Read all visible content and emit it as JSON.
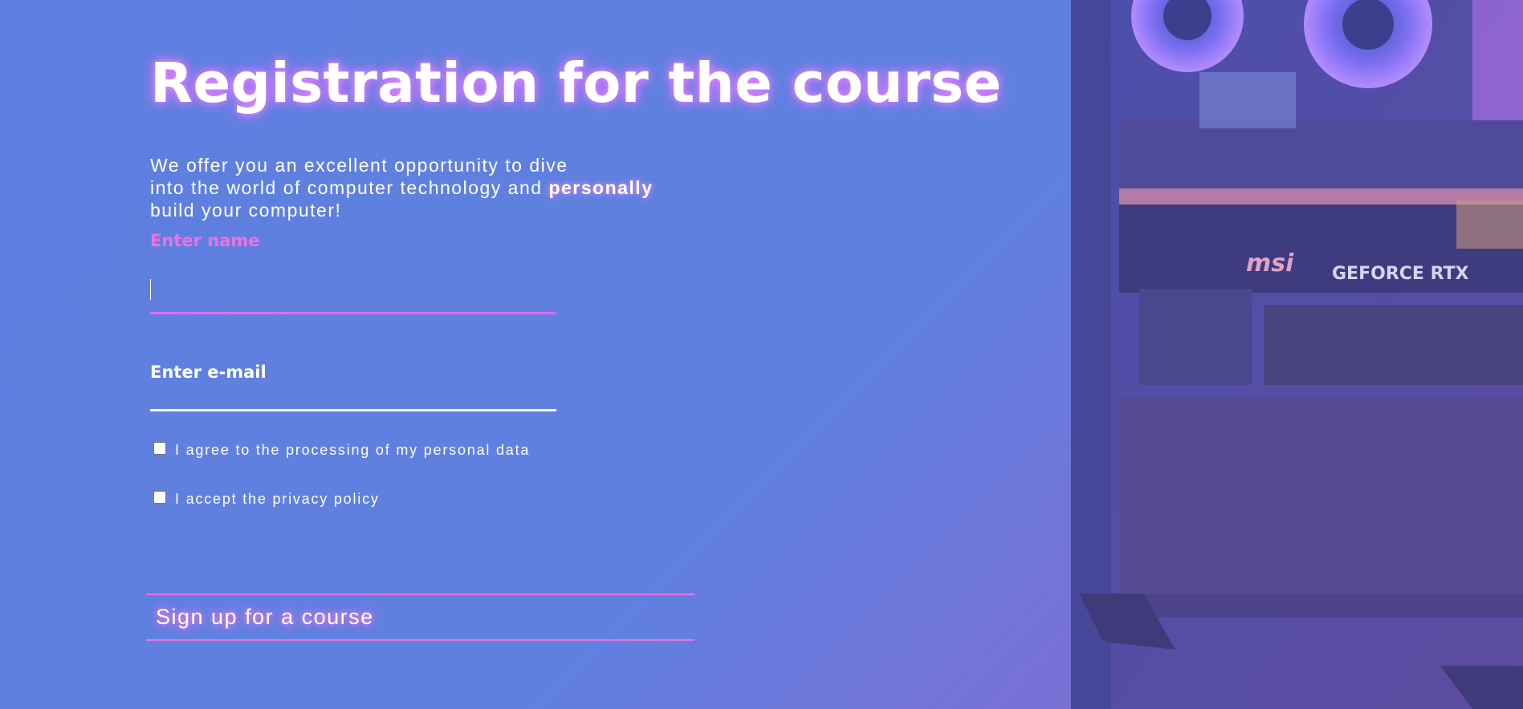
{
  "page": {
    "title": "Registration for the course",
    "description_line1": "We offer you an excellent opportunity to dive",
    "description_line2_prefix": "into the world of computer technology and ",
    "description_line2_emphasis": "personally",
    "description_line3": "build your computer!"
  },
  "form": {
    "name_label": "Enter name",
    "name_value": "",
    "email_label": "Enter e-mail",
    "email_value": "",
    "checkbox_personal_data": "I agree to the processing of my personal data",
    "checkbox_privacy": "I accept the privacy policy",
    "submit_label": "Sign up for a course"
  },
  "image": {
    "brand_text": "msi",
    "gpu_text": "GEFORCE RTX",
    "description": "pc-case-image"
  },
  "colors": {
    "background": "#6080e0",
    "accent_pink": "#ec72e0",
    "white": "#ffffff"
  }
}
